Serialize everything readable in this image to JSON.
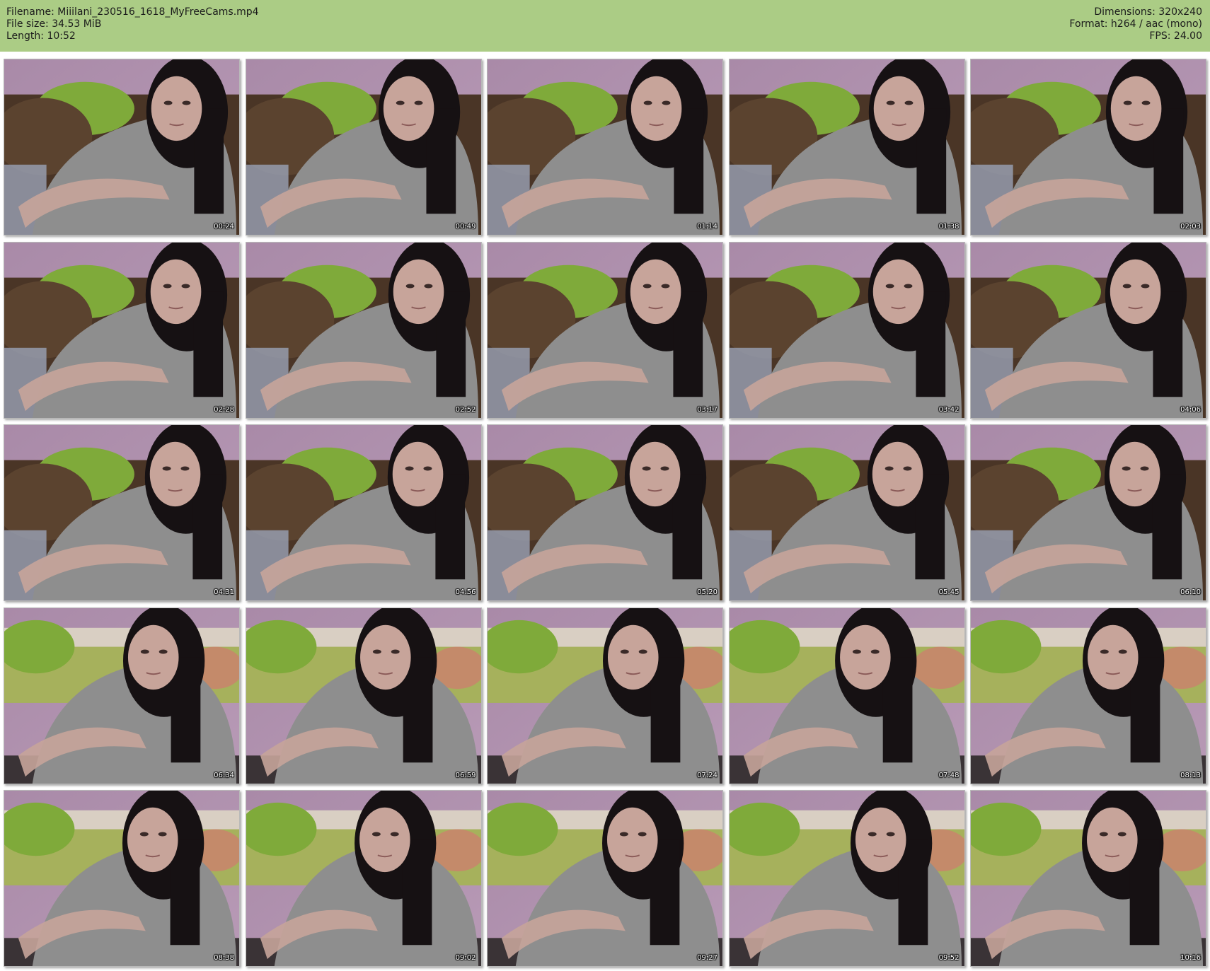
{
  "header": {
    "left": [
      "Filename: Miiilani_230516_1618_MyFreeCams.mp4",
      "File size: 34.53 MiB",
      "Length: 10:52"
    ],
    "right": [
      "Dimensions: 320x240",
      "Format: h264 / aac (mono)",
      "FPS: 24.00"
    ]
  },
  "colors": {
    "header_bg": "#abcc85",
    "wall": "#b89ab6",
    "pillow": "#7faa3a",
    "couch": "#4a3526",
    "shirt": "#8e8e8e",
    "hair": "#161113",
    "skin": "#c7a49a"
  },
  "thumbnails": [
    {
      "time": "00:24"
    },
    {
      "time": "00:49"
    },
    {
      "time": "01:14"
    },
    {
      "time": "01:38"
    },
    {
      "time": "02:03"
    },
    {
      "time": "02:28"
    },
    {
      "time": "02:52"
    },
    {
      "time": "03:17"
    },
    {
      "time": "03:42"
    },
    {
      "time": "04:06"
    },
    {
      "time": "04:31"
    },
    {
      "time": "04:56"
    },
    {
      "time": "05:20"
    },
    {
      "time": "05:45"
    },
    {
      "time": "06:10"
    },
    {
      "time": "06:34"
    },
    {
      "time": "06:59"
    },
    {
      "time": "07:24"
    },
    {
      "time": "07:48"
    },
    {
      "time": "08:13"
    },
    {
      "time": "08:38"
    },
    {
      "time": "09:02"
    },
    {
      "time": "09:27"
    },
    {
      "time": "09:52"
    },
    {
      "time": "10:16"
    }
  ]
}
